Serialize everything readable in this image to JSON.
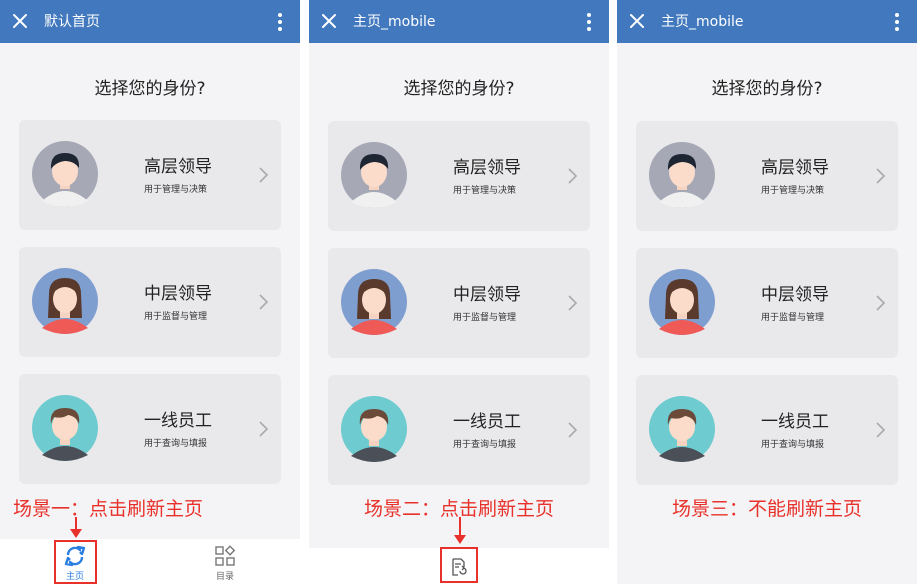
{
  "panels": [
    {
      "title": "默认首页",
      "question": "选择您的身份?",
      "cards": [
        {
          "title": "高层领导",
          "desc": "用于管理与决策"
        },
        {
          "title": "中层领导",
          "desc": "用于监督与管理"
        },
        {
          "title": "一线员工",
          "desc": "用于查询与填报"
        }
      ],
      "scenario": "场景一：点击刷新主页",
      "tabs": [
        {
          "label": "主页",
          "icon": "refresh-home-icon",
          "active": true
        },
        {
          "label": "目录",
          "icon": "catalog-grid-icon",
          "active": false
        }
      ]
    },
    {
      "title": "主页_mobile",
      "question": "选择您的身份?",
      "cards": [
        {
          "title": "高层领导",
          "desc": "用于管理与决策"
        },
        {
          "title": "中层领导",
          "desc": "用于监督与管理"
        },
        {
          "title": "一线员工",
          "desc": "用于查询与填报"
        }
      ],
      "scenario": "场景二：点击刷新主页",
      "tabs": [
        {
          "label": "",
          "icon": "refresh-document-icon",
          "active": false
        }
      ]
    },
    {
      "title": "主页_mobile",
      "question": "选择您的身份?",
      "cards": [
        {
          "title": "高层领导",
          "desc": "用于管理与决策"
        },
        {
          "title": "中层领导",
          "desc": "用于监督与管理"
        },
        {
          "title": "一线员工",
          "desc": "用于查询与填报"
        }
      ],
      "scenario": "场景三：不能刷新主页"
    }
  ],
  "colors": {
    "topbar": "#4178be",
    "highlight": "#e8312a",
    "active_tab": "#2a7de1",
    "inactive_tab": "#666666"
  }
}
